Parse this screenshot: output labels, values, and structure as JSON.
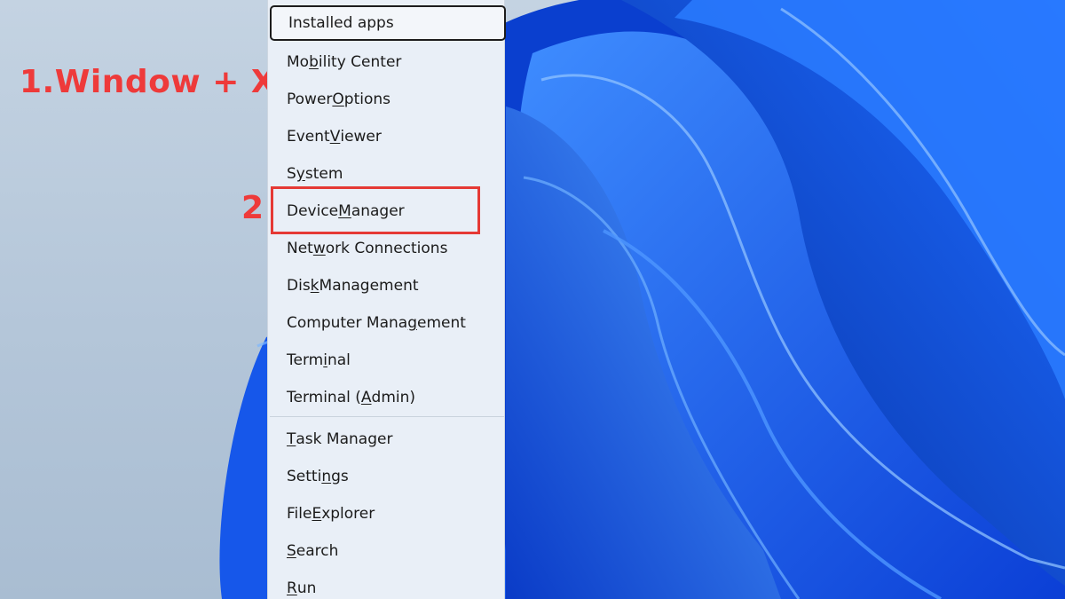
{
  "annotations": {
    "step1": "1.Window + X",
    "step2": "2"
  },
  "menu": {
    "items": [
      {
        "pre": "Installed apps",
        "ul": "",
        "post": ""
      },
      {
        "pre": "Mo",
        "ul": "b",
        "post": "ility Center"
      },
      {
        "pre": "Power ",
        "ul": "O",
        "post": "ptions"
      },
      {
        "pre": "Event ",
        "ul": "V",
        "post": "iewer"
      },
      {
        "pre": "S",
        "ul": "y",
        "post": "stem"
      },
      {
        "pre": "Device ",
        "ul": "M",
        "post": "anager"
      },
      {
        "pre": "Net",
        "ul": "w",
        "post": "ork Connections"
      },
      {
        "pre": "Dis",
        "ul": "k",
        "post": " Management"
      },
      {
        "pre": "Computer Mana",
        "ul": "g",
        "post": "ement"
      },
      {
        "pre": "Term",
        "ul": "i",
        "post": "nal"
      },
      {
        "pre": "Terminal (",
        "ul": "A",
        "post": "dmin)"
      },
      {
        "pre": "",
        "ul": "T",
        "post": "ask Manager"
      },
      {
        "pre": "Setti",
        "ul": "n",
        "post": "gs"
      },
      {
        "pre": "File ",
        "ul": "E",
        "post": "xplorer"
      },
      {
        "pre": "",
        "ul": "S",
        "post": "earch"
      },
      {
        "pre": "",
        "ul": "R",
        "post": "un"
      }
    ]
  },
  "colors": {
    "annotation": "#ee3a3a",
    "highlight_border": "#e53935",
    "wallpaper_blue": "#1a5ff0"
  }
}
